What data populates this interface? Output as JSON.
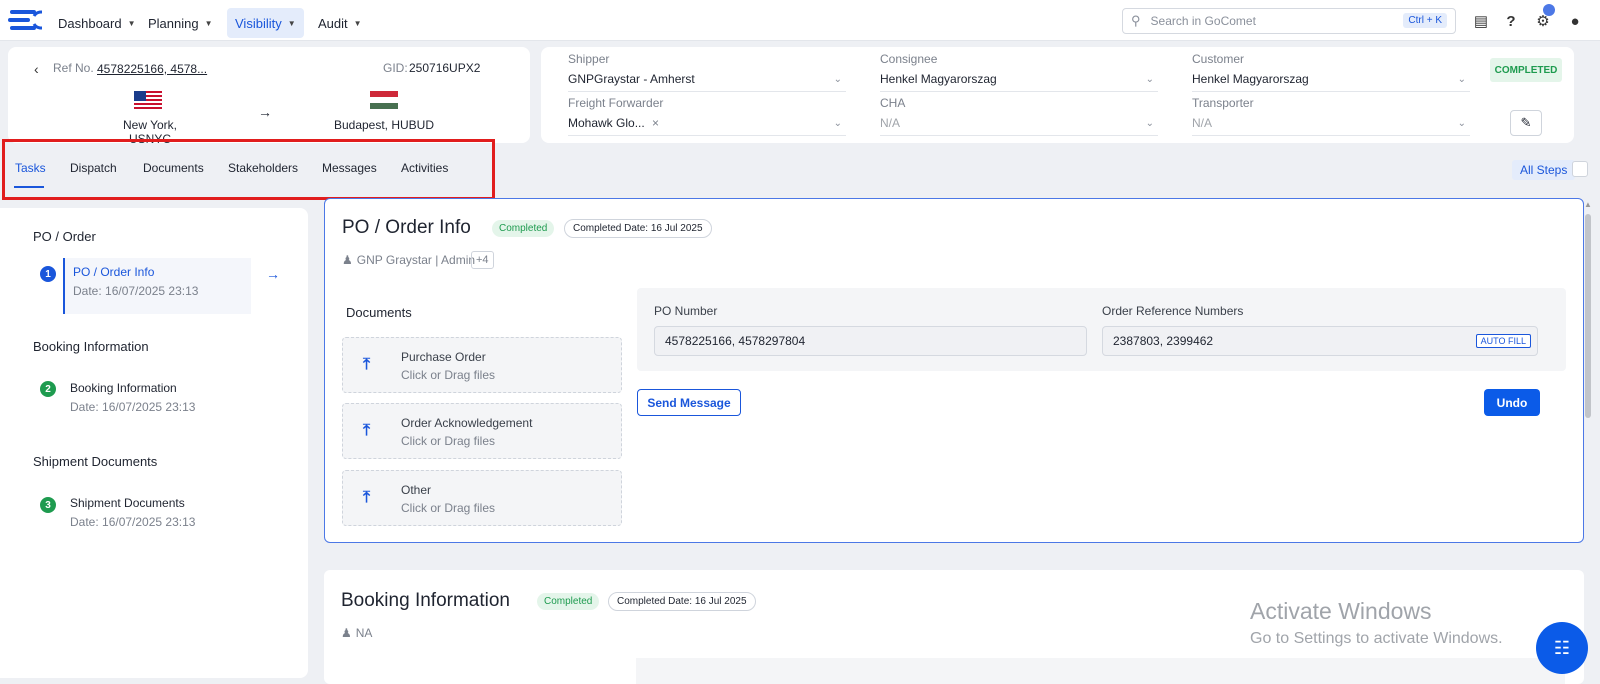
{
  "topbar": {
    "nav": [
      {
        "label": "Dashboard"
      },
      {
        "label": "Planning"
      },
      {
        "label": "Visibility"
      },
      {
        "label": "Audit"
      }
    ],
    "search_placeholder": "Search in GoComet",
    "search_shortcut": "Ctrl + K"
  },
  "shipment": {
    "ref_label": "Ref No.",
    "ref_value": "4578225166, 4578...",
    "gid_label": "GID:",
    "gid_value": "250716UPX2",
    "origin": "New York, USNYC",
    "destination": "Budapest, HUBUD"
  },
  "parties": {
    "shipper_label": "Shipper",
    "shipper_value": "GNPGraystar - Amherst",
    "consignee_label": "Consignee",
    "consignee_value": "Henkel Magyarorszag",
    "customer_label": "Customer",
    "customer_value": "Henkel Magyarorszag",
    "ff_label": "Freight Forwarder",
    "ff_value": "Mohawk Glo...",
    "cha_label": "CHA",
    "cha_value": "N/A",
    "transporter_label": "Transporter",
    "transporter_value": "N/A",
    "status": "COMPLETED"
  },
  "tabs": [
    {
      "label": "Tasks"
    },
    {
      "label": "Dispatch"
    },
    {
      "label": "Documents"
    },
    {
      "label": "Stakeholders"
    },
    {
      "label": "Messages"
    },
    {
      "label": "Activities"
    }
  ],
  "all_steps_label": "All Steps",
  "sidebar": {
    "sections": [
      {
        "title": "PO / Order",
        "step": {
          "num": "1",
          "title": "PO / Order Info",
          "date": "Date: 16/07/2025 23:13"
        }
      },
      {
        "title": "Booking Information",
        "step": {
          "num": "2",
          "title": "Booking Information",
          "date": "Date: 16/07/2025 23:13"
        }
      },
      {
        "title": "Shipment Documents",
        "step": {
          "num": "3",
          "title": "Shipment Documents",
          "date": "Date: 16/07/2025 23:13"
        }
      }
    ]
  },
  "po_panel": {
    "title": "PO / Order Info",
    "status": "Completed",
    "completed_date_label": "Completed Date:",
    "completed_date": "16 Jul 2025",
    "assignee": "GNP Graystar | Admin",
    "assignee_more": "+4",
    "documents_title": "Documents",
    "uploads": [
      {
        "title": "Purchase Order",
        "hint": "Click or Drag files"
      },
      {
        "title": "Order Acknowledgement",
        "hint": "Click or Drag files"
      },
      {
        "title": "Other",
        "hint": "Click or Drag files"
      }
    ],
    "po_number_label": "PO Number",
    "po_number_value": "4578225166, 4578297804",
    "order_ref_label": "Order Reference Numbers",
    "order_ref_value": "2387803, 2399462",
    "auto_fill": "AUTO FILL",
    "send_message": "Send Message",
    "undo": "Undo"
  },
  "booking_panel": {
    "title": "Booking Information",
    "status": "Completed",
    "completed_date_label": "Completed Date:",
    "completed_date": "16 Jul 2025",
    "assignee": "NA"
  },
  "watermark": {
    "line1": "Activate Windows",
    "line2": "Go to Settings to activate Windows."
  },
  "colors": {
    "accent": "#1a56db",
    "success": "#1e9b4f",
    "highlight": "#e11d1d"
  }
}
